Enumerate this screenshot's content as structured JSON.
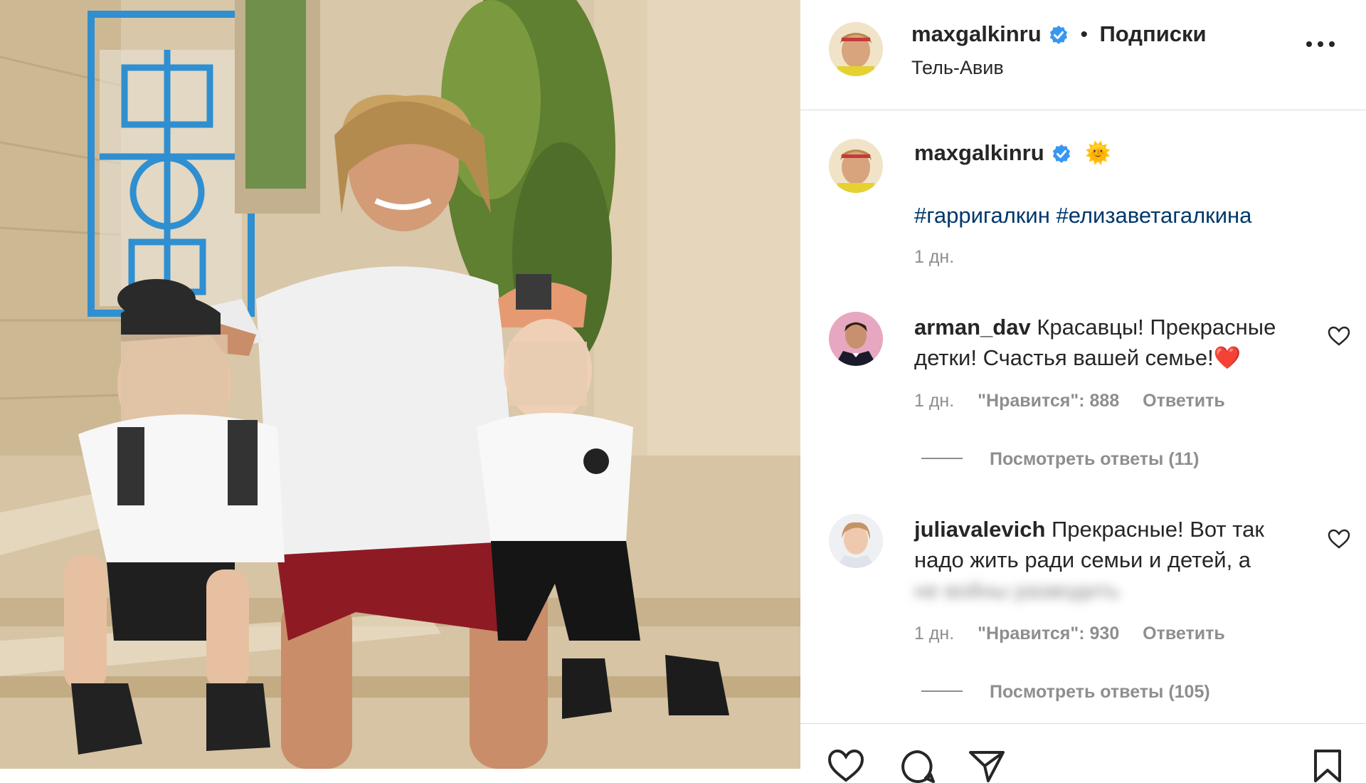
{
  "post": {
    "author": "maxgalkinru",
    "follow_label": "Подписки",
    "location": "Тель-Авив",
    "more_icon": "more-horizontal-icon"
  },
  "caption": {
    "author": "maxgalkinru",
    "emoji": "🌞",
    "hashtags": "#гарригалкин #елизаветагалкина",
    "time": "1 дн."
  },
  "comments": [
    {
      "author": "arman_dav",
      "text": "Красавцы! Прекрасные детки! Счастья вашей семье!",
      "emoji": "❤️",
      "time": "1 дн.",
      "likes": "\"Нравится\": 888",
      "reply": "Ответить",
      "view_replies": "Посмотреть ответы (11)"
    },
    {
      "author": "juliavalevich",
      "text": "Прекрасные! Вот так надо жить ради семьи и детей, а",
      "blurred_text": "не войны разводить",
      "time": "1 дн.",
      "likes": "\"Нравится\": 930",
      "reply": "Ответить",
      "view_replies": "Посмотреть ответы (105)"
    }
  ],
  "actions": [
    "heart-icon",
    "comment-icon",
    "share-icon",
    "bookmark-icon"
  ],
  "colors": {
    "text": "#262626",
    "muted": "#8e8e8e",
    "hashtag": "#00376b",
    "verified": "#3897f0",
    "heart": "#ed4956"
  }
}
